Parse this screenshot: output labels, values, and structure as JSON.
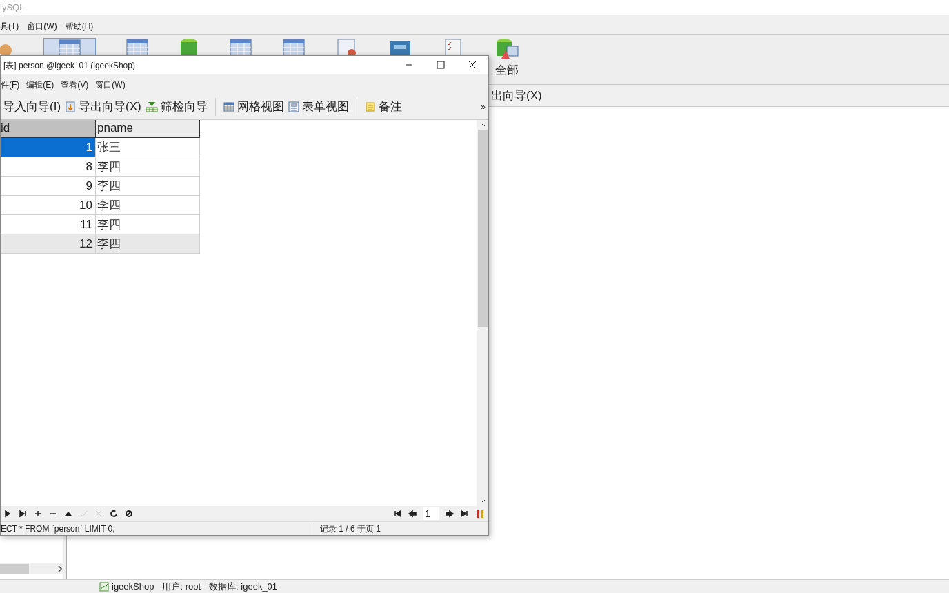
{
  "app": {
    "title": "lySQL",
    "menu": [
      "具(T)",
      "窗口(W)",
      "帮助(H)"
    ],
    "toolbar_label": "全部",
    "subbar_text": "出向导(X)",
    "status": {
      "connection": "igeekShop",
      "user": "用户: root",
      "database": "数据库: igeek_01"
    }
  },
  "window": {
    "title": "[表] person @igeek_01 (igeekShop)",
    "menu": [
      "件(F)",
      "编辑(E)",
      "查看(V)",
      "窗口(W)"
    ],
    "toolbar": [
      {
        "label": "导入向导(I)",
        "kind": "plain"
      },
      {
        "label": "导出向导(X)",
        "kind": "export"
      },
      {
        "label": "筛检向导",
        "kind": "filter"
      },
      {
        "label": "网格视图",
        "kind": "grid"
      },
      {
        "label": "表单视图",
        "kind": "form"
      },
      {
        "label": "备注",
        "kind": "note"
      }
    ],
    "more": "»",
    "table": {
      "columns": [
        "id",
        "pname"
      ],
      "rows": [
        {
          "id": "1",
          "pname": "张三",
          "selected": true,
          "hovered": false
        },
        {
          "id": "8",
          "pname": "李四",
          "selected": false,
          "hovered": false
        },
        {
          "id": "9",
          "pname": "李四",
          "selected": false,
          "hovered": false
        },
        {
          "id": "10",
          "pname": "李四",
          "selected": false,
          "hovered": false
        },
        {
          "id": "11",
          "pname": "李四",
          "selected": false,
          "hovered": false
        },
        {
          "id": "12",
          "pname": "李四",
          "selected": false,
          "hovered": true
        }
      ]
    },
    "page": "1",
    "sql": "ECT * FROM `person` LIMIT 0,",
    "records": "记录 1 / 6 于页 1"
  }
}
